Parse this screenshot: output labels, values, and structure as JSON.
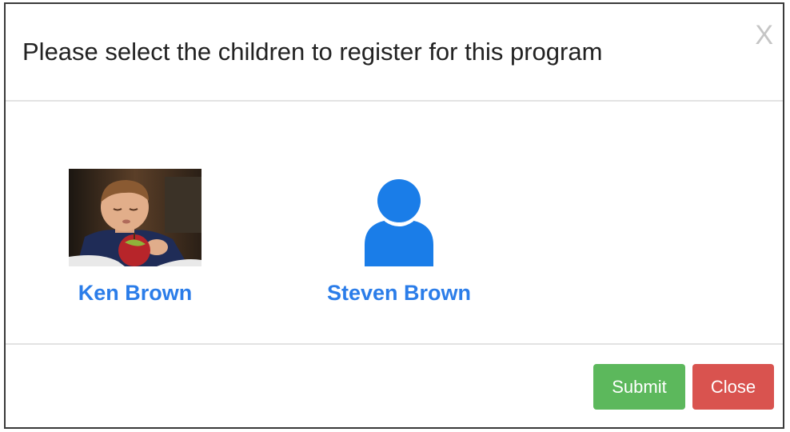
{
  "modal": {
    "title": "Please select the children to register for this program",
    "close_glyph": "X"
  },
  "children": [
    {
      "name": "Ken Brown",
      "avatar": "photo-of-boy-eating-apple"
    },
    {
      "name": "Steven Brown",
      "avatar": "user-icon"
    }
  ],
  "footer": {
    "submit_label": "Submit",
    "close_label": "Close"
  },
  "colors": {
    "link_blue": "#2b7de9",
    "submit_green": "#5cb85c",
    "close_red": "#d9534f"
  }
}
